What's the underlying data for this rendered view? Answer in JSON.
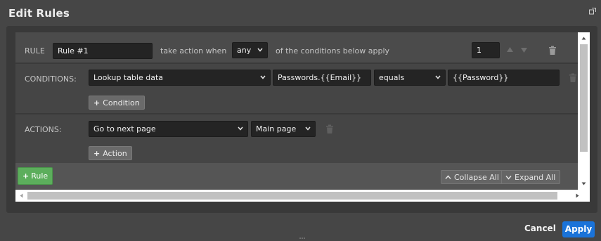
{
  "dialog": {
    "title": "Edit Rules"
  },
  "rule": {
    "label": "RULE",
    "name_value": "Rule #1",
    "take_action_text": "take action when",
    "match_value": "any",
    "conditions_apply_text": "of the conditions below apply",
    "priority_value": "1"
  },
  "conditions": {
    "label": "CONDITIONS:",
    "items": [
      {
        "source": "Lookup table data",
        "field": "Passwords.{{Email}}",
        "operator": "equals",
        "value": "{{Password}}"
      }
    ],
    "add_label": "Condition"
  },
  "actions": {
    "label": "ACTIONS:",
    "items": [
      {
        "action": "Go to next page",
        "target": "Main page"
      }
    ],
    "add_label": "Action"
  },
  "footer": {
    "add_rule_label": "Rule",
    "collapse_all_label": "Collapse All",
    "expand_all_label": "Expand All"
  },
  "buttons": {
    "cancel_label": "Cancel",
    "apply_label": "Apply"
  },
  "colors": {
    "accent": "#1a73d9",
    "add_rule": "#5cae5c",
    "background": "#464646"
  },
  "icons": [
    "popout-icon",
    "chevron-down-icon",
    "arrow-up-icon",
    "arrow-down-icon",
    "trash-icon",
    "plus-icon",
    "chevron-up-icon"
  ]
}
